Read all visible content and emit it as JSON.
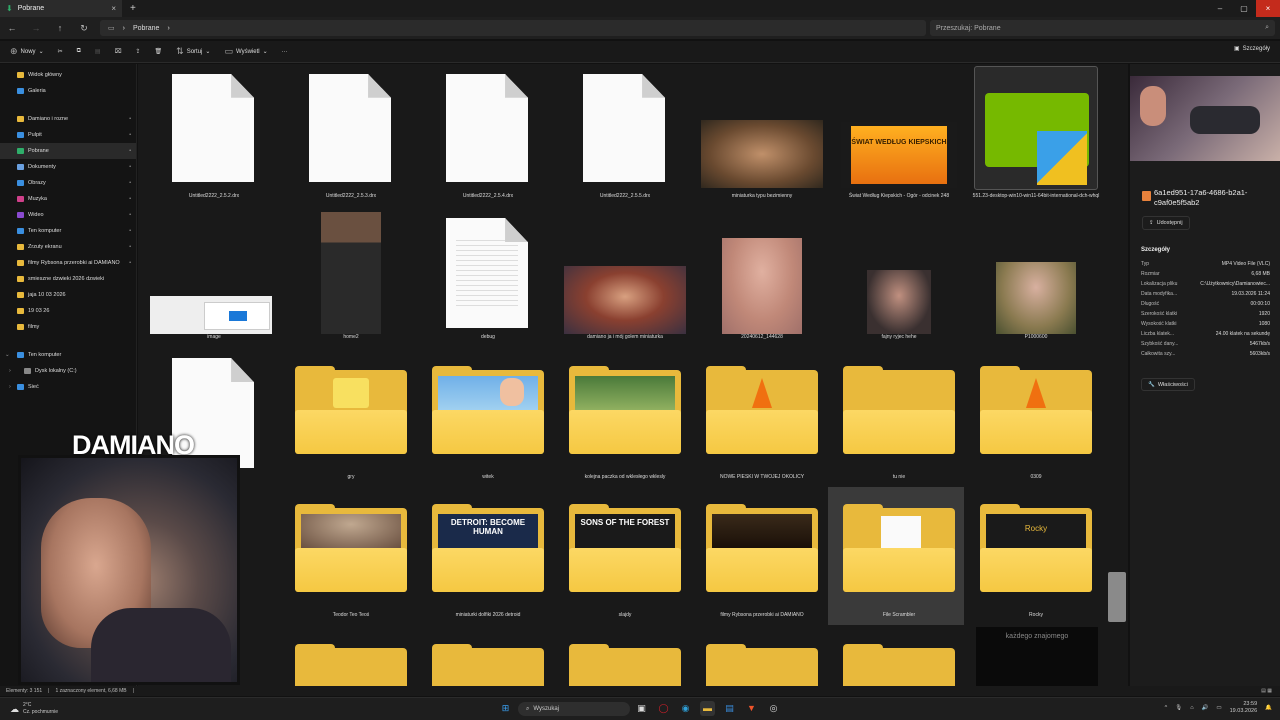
{
  "window": {
    "tab_title": "Pobrane",
    "tab_close": "×",
    "new_tab": "+",
    "controls": [
      "–",
      "▢",
      "×"
    ]
  },
  "address": {
    "path": "Pobrane",
    "chevron": "›",
    "search_placeholder": "Przeszukaj: Pobrane"
  },
  "toolbar": {
    "new": "Nowy",
    "sort": "Sortuj",
    "view": "Wyświetl",
    "more": "···",
    "details": "Szczegóły"
  },
  "sidebar": {
    "top": [
      {
        "label": "Widok główny",
        "color": "#e8b93c"
      },
      {
        "label": "Galeria",
        "color": "#3a8fe0"
      }
    ],
    "pinned": [
      {
        "label": "Damiano i rozne",
        "color": "#e8b93c",
        "pin": "📌"
      },
      {
        "label": "Pulpit",
        "color": "#3a8fe0",
        "pin": "📌"
      },
      {
        "label": "Pobrane",
        "color": "#2fae6a",
        "pin": "📌"
      },
      {
        "label": "Dokumenty",
        "color": "#6aa0e0",
        "pin": "📌"
      },
      {
        "label": "Obrazy",
        "color": "#3a8fe0",
        "pin": "📌"
      },
      {
        "label": "Muzyka",
        "color": "#d0408a",
        "pin": "📌"
      },
      {
        "label": "Wideo",
        "color": "#8a4ad0",
        "pin": "📌"
      },
      {
        "label": "Ten komputer",
        "color": "#3a8fe0",
        "pin": "📌"
      },
      {
        "label": "Zrzuty ekranu",
        "color": "#e8b93c",
        "pin": "📌"
      },
      {
        "label": "filmy Rybsona przerobki ai DAMIANO",
        "color": "#e8b93c",
        "pin": "📌"
      },
      {
        "label": "smieszne dzwieki 2026 dzwieki",
        "color": "#e8b93c",
        "pin": ""
      },
      {
        "label": "jaja 10 03 2026",
        "color": "#e8b93c",
        "pin": ""
      },
      {
        "label": "19 03 26",
        "color": "#e8b93c",
        "pin": ""
      },
      {
        "label": "filmy",
        "color": "#e8b93c",
        "pin": ""
      }
    ],
    "tree": [
      {
        "label": "Ten komputer",
        "color": "#3a8fe0",
        "arrow": "⌄"
      },
      {
        "label": "Dysk lokalny (C:)",
        "color": "#888",
        "arrow": "›"
      },
      {
        "label": "Sieć",
        "color": "#3a8fe0",
        "arrow": "›"
      }
    ]
  },
  "files": {
    "row1": [
      "Untitled2222_2.5.2.drx",
      "Untitled2222_2.5.3.drx",
      "Untitled2222_2.5.4.drx",
      "Untitled2222_2.5.5.drx",
      "miniaturka typu bezimienny",
      "Świat Według Kiepskich - Ogór - odcinek 248",
      "551.23-desktop-win10-win11-64bit-international-dch-whql"
    ],
    "row2": [
      "image",
      "home2",
      "debug",
      "damiano ja i mój golem miniaturka",
      "20240612_144628",
      "fajny ryjec hehe",
      "P1000600"
    ],
    "row3": [
      "gry",
      "witek",
      "kolejna paczka od wklesłego wklesly",
      "NOWE PIESKI W TWOJEJ OKOLICY",
      "tu nie",
      "0309"
    ],
    "row4": [
      "Teodor Teo Teoś",
      "miniaturki dolfiki 2026 detroid",
      "slajdy",
      "filmy Rybsona przerobki ai DAMIANO",
      "File Scrambler",
      "Rocky"
    ],
    "thumb_texts": {
      "kiepscy": "ŚWIAT WEDŁUG KIEPSKICH",
      "detroit": "DETROIT: BECOME HUMAN",
      "sons": "SONS OF THE FOREST",
      "rocky": "Rocky",
      "bottom": "każdego znajomego"
    }
  },
  "details_pane": {
    "filename": "6a1ed951-17a6-4686-b2a1-c9af0e5f5ab2",
    "share": "Udostępnij",
    "heading": "Szczegóły",
    "rows": [
      {
        "k": "Typ",
        "v": "MP4 Video File (VLC)"
      },
      {
        "k": "Rozmiar",
        "v": "6,68 MB"
      },
      {
        "k": "Lokalizacja pliku",
        "v": "C:\\Użytkownicy\\Damianowiec..."
      },
      {
        "k": "Data modyfika...",
        "v": "19.03.2026 11:24"
      },
      {
        "k": "Długość",
        "v": "00:00:10"
      },
      {
        "k": "Szerokość klatki",
        "v": "1920"
      },
      {
        "k": "Wysokość klatki",
        "v": "1080"
      },
      {
        "k": "Liczba klatek...",
        "v": "24.00 klatek na sekundę"
      },
      {
        "k": "Szybkość dany...",
        "v": "5467kb/s"
      },
      {
        "k": "Całkowita szy...",
        "v": "5603kb/s"
      }
    ],
    "properties": "Właściwości"
  },
  "status": {
    "elements": "Elementy: 3 151",
    "selected": "1 zaznaczony element, 6,68 MB"
  },
  "taskbar": {
    "temp": "2°C",
    "weather": "Cz. pochmurnie",
    "search": "Wyszukaj",
    "time": "23:59",
    "date": "19.03.2026"
  },
  "overlay": {
    "streamer": "DAMIANO"
  },
  "colors": {
    "accent": "#e8b93c",
    "close": "#c42b1c"
  }
}
